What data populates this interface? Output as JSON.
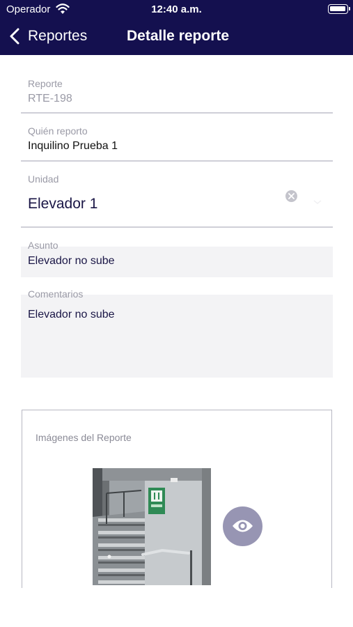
{
  "status_bar": {
    "carrier": "Operador",
    "time": "12:40 a.m.",
    "wifi_icon": "wifi-icon",
    "battery_icon": "battery-icon"
  },
  "nav": {
    "back_label": "Reportes",
    "back_icon": "chevron-left-icon",
    "title": "Detalle reporte",
    "bar_color": "#14104f"
  },
  "form": {
    "reporte": {
      "label": "Reporte",
      "value": "RTE-198"
    },
    "quien_reporto": {
      "label": "Quién reporto",
      "value": "Inquilino Prueba 1"
    },
    "unidad": {
      "label": "Unidad",
      "value": "Elevador 1",
      "clear_icon": "clear-circle-icon"
    },
    "asunto": {
      "label": "Asunto",
      "value": "Elevador no sube"
    },
    "comentarios": {
      "label": "Comentarios",
      "value": "Elevador no sube"
    }
  },
  "images": {
    "title": "Imágenes del Reporte",
    "view_icon": "eye-icon",
    "view_button_color": "#9795b3"
  }
}
